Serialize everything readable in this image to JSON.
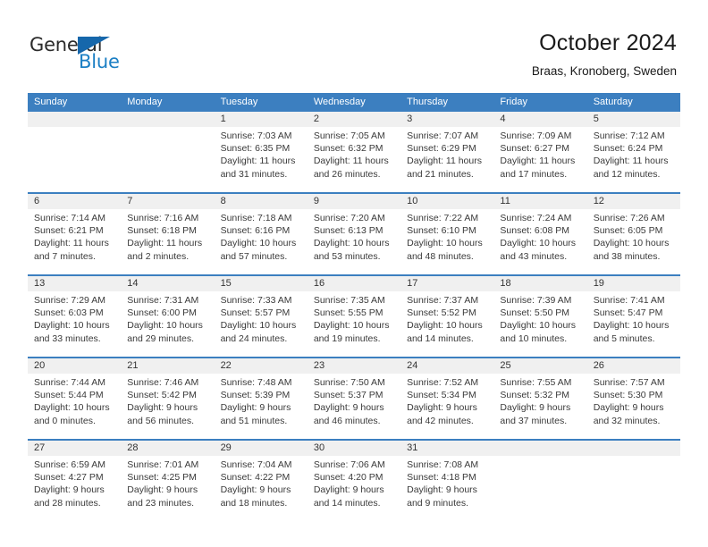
{
  "brand": {
    "name_part1": "General",
    "name_part2": "Blue",
    "logo_icon": "triangle-icon",
    "accent_color": "#1b7fc4",
    "header_color": "#3c7fc0"
  },
  "header": {
    "title": "October 2024",
    "subtitle": "Braas, Kronoberg, Sweden"
  },
  "weekdays": [
    "Sunday",
    "Monday",
    "Tuesday",
    "Wednesday",
    "Thursday",
    "Friday",
    "Saturday"
  ],
  "weeks": [
    {
      "numbers": [
        "",
        "",
        "1",
        "2",
        "3",
        "4",
        "5"
      ],
      "cells": [
        {
          "lines": []
        },
        {
          "lines": []
        },
        {
          "lines": [
            "Sunrise: 7:03 AM",
            "Sunset: 6:35 PM",
            "Daylight: 11 hours",
            "and 31 minutes."
          ]
        },
        {
          "lines": [
            "Sunrise: 7:05 AM",
            "Sunset: 6:32 PM",
            "Daylight: 11 hours",
            "and 26 minutes."
          ]
        },
        {
          "lines": [
            "Sunrise: 7:07 AM",
            "Sunset: 6:29 PM",
            "Daylight: 11 hours",
            "and 21 minutes."
          ]
        },
        {
          "lines": [
            "Sunrise: 7:09 AM",
            "Sunset: 6:27 PM",
            "Daylight: 11 hours",
            "and 17 minutes."
          ]
        },
        {
          "lines": [
            "Sunrise: 7:12 AM",
            "Sunset: 6:24 PM",
            "Daylight: 11 hours",
            "and 12 minutes."
          ]
        }
      ]
    },
    {
      "numbers": [
        "6",
        "7",
        "8",
        "9",
        "10",
        "11",
        "12"
      ],
      "cells": [
        {
          "lines": [
            "Sunrise: 7:14 AM",
            "Sunset: 6:21 PM",
            "Daylight: 11 hours",
            "and 7 minutes."
          ]
        },
        {
          "lines": [
            "Sunrise: 7:16 AM",
            "Sunset: 6:18 PM",
            "Daylight: 11 hours",
            "and 2 minutes."
          ]
        },
        {
          "lines": [
            "Sunrise: 7:18 AM",
            "Sunset: 6:16 PM",
            "Daylight: 10 hours",
            "and 57 minutes."
          ]
        },
        {
          "lines": [
            "Sunrise: 7:20 AM",
            "Sunset: 6:13 PM",
            "Daylight: 10 hours",
            "and 53 minutes."
          ]
        },
        {
          "lines": [
            "Sunrise: 7:22 AM",
            "Sunset: 6:10 PM",
            "Daylight: 10 hours",
            "and 48 minutes."
          ]
        },
        {
          "lines": [
            "Sunrise: 7:24 AM",
            "Sunset: 6:08 PM",
            "Daylight: 10 hours",
            "and 43 minutes."
          ]
        },
        {
          "lines": [
            "Sunrise: 7:26 AM",
            "Sunset: 6:05 PM",
            "Daylight: 10 hours",
            "and 38 minutes."
          ]
        }
      ]
    },
    {
      "numbers": [
        "13",
        "14",
        "15",
        "16",
        "17",
        "18",
        "19"
      ],
      "cells": [
        {
          "lines": [
            "Sunrise: 7:29 AM",
            "Sunset: 6:03 PM",
            "Daylight: 10 hours",
            "and 33 minutes."
          ]
        },
        {
          "lines": [
            "Sunrise: 7:31 AM",
            "Sunset: 6:00 PM",
            "Daylight: 10 hours",
            "and 29 minutes."
          ]
        },
        {
          "lines": [
            "Sunrise: 7:33 AM",
            "Sunset: 5:57 PM",
            "Daylight: 10 hours",
            "and 24 minutes."
          ]
        },
        {
          "lines": [
            "Sunrise: 7:35 AM",
            "Sunset: 5:55 PM",
            "Daylight: 10 hours",
            "and 19 minutes."
          ]
        },
        {
          "lines": [
            "Sunrise: 7:37 AM",
            "Sunset: 5:52 PM",
            "Daylight: 10 hours",
            "and 14 minutes."
          ]
        },
        {
          "lines": [
            "Sunrise: 7:39 AM",
            "Sunset: 5:50 PM",
            "Daylight: 10 hours",
            "and 10 minutes."
          ]
        },
        {
          "lines": [
            "Sunrise: 7:41 AM",
            "Sunset: 5:47 PM",
            "Daylight: 10 hours",
            "and 5 minutes."
          ]
        }
      ]
    },
    {
      "numbers": [
        "20",
        "21",
        "22",
        "23",
        "24",
        "25",
        "26"
      ],
      "cells": [
        {
          "lines": [
            "Sunrise: 7:44 AM",
            "Sunset: 5:44 PM",
            "Daylight: 10 hours",
            "and 0 minutes."
          ]
        },
        {
          "lines": [
            "Sunrise: 7:46 AM",
            "Sunset: 5:42 PM",
            "Daylight: 9 hours",
            "and 56 minutes."
          ]
        },
        {
          "lines": [
            "Sunrise: 7:48 AM",
            "Sunset: 5:39 PM",
            "Daylight: 9 hours",
            "and 51 minutes."
          ]
        },
        {
          "lines": [
            "Sunrise: 7:50 AM",
            "Sunset: 5:37 PM",
            "Daylight: 9 hours",
            "and 46 minutes."
          ]
        },
        {
          "lines": [
            "Sunrise: 7:52 AM",
            "Sunset: 5:34 PM",
            "Daylight: 9 hours",
            "and 42 minutes."
          ]
        },
        {
          "lines": [
            "Sunrise: 7:55 AM",
            "Sunset: 5:32 PM",
            "Daylight: 9 hours",
            "and 37 minutes."
          ]
        },
        {
          "lines": [
            "Sunrise: 7:57 AM",
            "Sunset: 5:30 PM",
            "Daylight: 9 hours",
            "and 32 minutes."
          ]
        }
      ]
    },
    {
      "numbers": [
        "27",
        "28",
        "29",
        "30",
        "31",
        "",
        ""
      ],
      "cells": [
        {
          "lines": [
            "Sunrise: 6:59 AM",
            "Sunset: 4:27 PM",
            "Daylight: 9 hours",
            "and 28 minutes."
          ]
        },
        {
          "lines": [
            "Sunrise: 7:01 AM",
            "Sunset: 4:25 PM",
            "Daylight: 9 hours",
            "and 23 minutes."
          ]
        },
        {
          "lines": [
            "Sunrise: 7:04 AM",
            "Sunset: 4:22 PM",
            "Daylight: 9 hours",
            "and 18 minutes."
          ]
        },
        {
          "lines": [
            "Sunrise: 7:06 AM",
            "Sunset: 4:20 PM",
            "Daylight: 9 hours",
            "and 14 minutes."
          ]
        },
        {
          "lines": [
            "Sunrise: 7:08 AM",
            "Sunset: 4:18 PM",
            "Daylight: 9 hours",
            "and 9 minutes."
          ]
        },
        {
          "lines": []
        },
        {
          "lines": []
        }
      ]
    }
  ]
}
